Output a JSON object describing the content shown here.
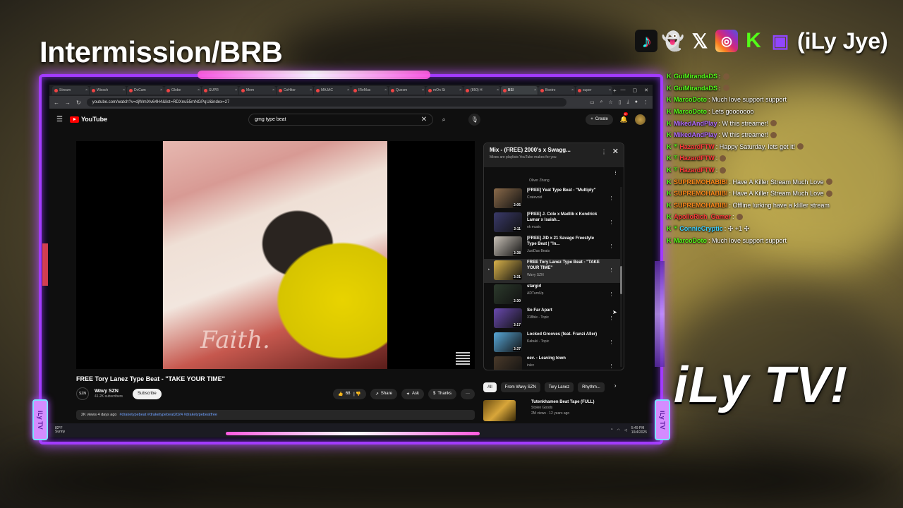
{
  "overlay": {
    "title": "Intermission/BRB",
    "handle": "(iLy Jye)",
    "brand": "iLy TV!",
    "badge": "iLy TV",
    "socials": [
      {
        "name": "tiktok-icon",
        "glyph": "♪"
      },
      {
        "name": "snapchat-icon",
        "glyph": "👻"
      },
      {
        "name": "x-icon",
        "glyph": "𝕏"
      },
      {
        "name": "instagram-icon",
        "glyph": "◎"
      },
      {
        "name": "kick-icon",
        "glyph": "K"
      },
      {
        "name": "twitch-icon",
        "glyph": "▣"
      }
    ]
  },
  "browser": {
    "tabs": [
      "Stream",
      "Wixsch",
      "DvCam",
      "Globe",
      "SUPR",
      "Mem",
      "CoHitor",
      "MAJAC",
      "IReMus",
      "Quesm",
      "mOn St",
      "(850) H",
      "BSl",
      "Boxtro",
      "super"
    ],
    "url": "youtube.com/watch?v=djWmlXv64H4&list=RDXnu55mNGPqU&index=27"
  },
  "youtube": {
    "logo": "YouTube",
    "search_value": "gmg type beat",
    "create_label": "Create",
    "notif_count": "9+",
    "video_overlay_text": "Faith.",
    "video_title": "FREE Tory Lanez Type Beat - \"TAKE YOUR TIME\"",
    "channel": {
      "name": "Wavy SZN",
      "subs": "41.2K subscribers"
    },
    "subscribe_label": "Subscribe",
    "likes": "68",
    "share_label": "Share",
    "ask_label": "Ask",
    "thanks_label": "Thanks",
    "more_label": "···",
    "description": {
      "meta": "2K views  4 days ago",
      "tags": "#draketypebeat #draketypebeat2024 #draketypebeatfree"
    }
  },
  "playlist": {
    "title": "Mix - (FREE) 2000's x Swagg...",
    "subtitle": "Mixes are playlists YouTube makes for you",
    "top_fragment": "Oliver Zhang",
    "items": [
      {
        "title": "[FREE] Yeat Type Beat - \"Multiply\"",
        "channel": "Cratevoid",
        "duration": "2:05",
        "color": "#8a6a4a"
      },
      {
        "title": "[FREE] J. Cole x Madlib x Kendrick Lamar x Isaiah...",
        "channel": "nk music",
        "duration": "2:11",
        "color": "#3a3a6a"
      },
      {
        "title": "[FREE] JID x 21 Savage Freestyle Type Beat | \"In...",
        "channel": "JustDas Beats",
        "duration": "3:38",
        "color": "#c9c2b8"
      },
      {
        "title": "FREE Tory Lanez Type Beat - \"TAKE YOUR TIME\"",
        "channel": "Wavy SZN",
        "duration": "3:31",
        "color": "#d8b24a",
        "active": true
      },
      {
        "title": "stargirl",
        "channel": "ADTurnUp",
        "duration": "2:30",
        "color": "#2c3a2c"
      },
      {
        "title": "So Far Apart",
        "channel": "318ble - Topic",
        "duration": "3:17",
        "color": "#6a4ab0"
      },
      {
        "title": "Locked Grooves (feat. Franzi Aller)",
        "channel": "Kabuki - Topic",
        "duration": "3:37",
        "color": "#58a8d8"
      },
      {
        "title": "eev. - Leaving town",
        "channel": "inlec",
        "duration": "",
        "color": "#4a3a2a"
      }
    ]
  },
  "chips": [
    "All",
    "From Wavy SZN",
    "Tory Lanez",
    "Rhythm..."
  ],
  "recommendation": {
    "title": "Tutenkhamen Beat Tape (FULL)",
    "channel": "Stolen Goods",
    "meta": "2M views · 12 years ago"
  },
  "taskbar": {
    "temp": "82°F",
    "weather": "Sunny",
    "time": "5:49 PM",
    "date": "10/4/2025"
  },
  "chat": [
    {
      "user": "GuiMirandaDS",
      "color": "#53fc18",
      "msg": " :",
      "emote": true
    },
    {
      "user": "GuiMirandaDS",
      "color": "#53fc18",
      "msg": " :",
      "emote": true
    },
    {
      "user": "MarcoDoto",
      "color": "#53fc18",
      "msg": " : Much love support support"
    },
    {
      "user": "MarcoDoto",
      "color": "#53fc18",
      "msg": " : Lets gooooooo"
    },
    {
      "user": "MikedAndPlay",
      "color": "#b26bff",
      "msg": " : W this streamer!",
      "emote": true
    },
    {
      "user": "MikedAndPlay",
      "color": "#b26bff",
      "msg": " : W this streamer!",
      "emote": true
    },
    {
      "user": "HazardFTW",
      "color": "#ff3b3b",
      "msg": " : Happy Saturday, lets get it!",
      "emote": true,
      "shield": true
    },
    {
      "user": "HazardFTW",
      "color": "#ff3b3b",
      "msg": " :",
      "emote": true,
      "shield": true
    },
    {
      "user": "HazardFTW",
      "color": "#ff3b3b",
      "msg": " :",
      "emote": true,
      "shield": true
    },
    {
      "user": "SUPREMOHABIBI",
      "color": "#ff8a1a",
      "msg": " : Have A Killer Stream Much Love",
      "emote": true
    },
    {
      "user": "SUPREMOHABIBI",
      "color": "#ff8a1a",
      "msg": " : Have A Killer Stream Much Love",
      "emote": true
    },
    {
      "user": "SUPREMOHABIBI",
      "color": "#ff8a1a",
      "msg": " : Offline lurking have a kliller stream"
    },
    {
      "user": "ApolloRich_Gamer",
      "color": "#ff3b3b",
      "msg": " :",
      "emote": true
    },
    {
      "user": "ConnieCryptic",
      "color": "#3bd0ff",
      "msg": " : ✣ +1 ✣",
      "shield": true
    },
    {
      "user": "MarcoDoto",
      "color": "#53fc18",
      "msg": " : Much love support support"
    }
  ],
  "colors": {
    "frame": "#a23bff",
    "kick": "#53fc18",
    "yt_red": "#ff0000"
  }
}
